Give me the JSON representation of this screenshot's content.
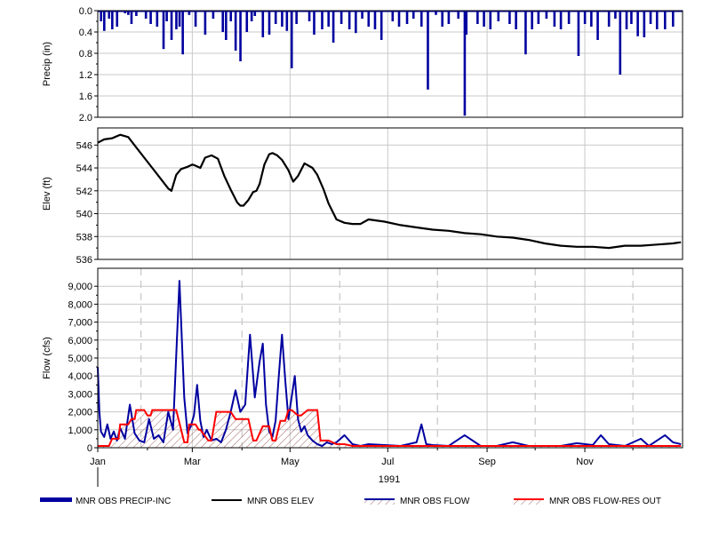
{
  "chart_data": [
    {
      "type": "bar",
      "ylabel": "Precip (in)",
      "ylim": [
        0,
        2.0
      ],
      "inverted_y": true,
      "y_ticks": [
        "0.0",
        "0.4",
        "0.8",
        "1.2",
        "1.6",
        "2.0"
      ],
      "grid": true,
      "series": [
        {
          "name": "MNR OBS PRECIP-INC",
          "color": "#0000a0",
          "day_of_year": [
            3,
            5,
            8,
            10,
            13,
            18,
            20,
            22,
            25,
            31,
            34,
            38,
            42,
            44,
            47,
            50,
            52,
            54,
            58,
            62,
            68,
            73,
            79,
            81,
            84,
            87,
            90,
            94,
            97,
            99,
            104,
            108,
            112,
            116,
            119,
            122,
            125,
            133,
            136,
            141,
            145,
            148,
            153,
            158,
            162,
            166,
            170,
            174,
            178,
            185,
            189,
            194,
            198,
            203,
            207,
            212,
            216,
            220,
            226,
            230,
            231,
            238,
            242,
            246,
            251,
            258,
            262,
            268,
            272,
            276,
            281,
            286,
            290,
            295,
            301,
            305,
            309,
            313,
            320,
            324,
            327,
            331,
            334,
            338,
            342,
            346,
            350,
            355,
            360
          ],
          "values": [
            0.2,
            0.38,
            0.15,
            0.35,
            0.3,
            0.05,
            0.08,
            0.25,
            0.1,
            0.15,
            0.25,
            0.3,
            0.72,
            0.2,
            0.55,
            0.35,
            0.3,
            0.82,
            0.08,
            0.3,
            0.45,
            0.15,
            0.4,
            0.55,
            0.2,
            0.75,
            0.95,
            0.4,
            0.2,
            0.1,
            0.5,
            0.45,
            0.25,
            0.3,
            0.38,
            1.08,
            0.25,
            0.2,
            0.45,
            0.35,
            0.3,
            0.6,
            0.25,
            0.35,
            0.42,
            0.15,
            0.3,
            0.35,
            0.55,
            0.2,
            0.3,
            0.25,
            0.15,
            0.3,
            1.48,
            0.08,
            0.3,
            0.25,
            0.15,
            1.97,
            0.45,
            0.25,
            0.3,
            0.35,
            0.2,
            0.25,
            0.35,
            0.82,
            0.35,
            0.25,
            0.15,
            0.3,
            0.35,
            0.25,
            0.85,
            0.25,
            0.3,
            0.55,
            0.3,
            0.15,
            1.2,
            0.35,
            0.25,
            0.48,
            0.5,
            0.25,
            0.35,
            0.35,
            0.3
          ]
        }
      ]
    },
    {
      "type": "line",
      "ylabel": "Elev (ft)",
      "ylim": [
        536,
        547.5
      ],
      "y_ticks": [
        "536",
        "538",
        "540",
        "542",
        "544",
        "546"
      ],
      "grid": true,
      "series": [
        {
          "name": "MNR OBS ELEV",
          "color": "#000000",
          "day_of_year": [
            1,
            5,
            10,
            15,
            20,
            25,
            30,
            35,
            40,
            45,
            47,
            50,
            53,
            57,
            60,
            62,
            65,
            68,
            72,
            76,
            80,
            84,
            88,
            90,
            92,
            95,
            98,
            100,
            102,
            105,
            108,
            110,
            113,
            116,
            120,
            123,
            126,
            130,
            135,
            138,
            142,
            145,
            150,
            155,
            160,
            165,
            170,
            180,
            190,
            200,
            210,
            220,
            230,
            240,
            250,
            260,
            270,
            280,
            290,
            300,
            310,
            320,
            330,
            340,
            350,
            360,
            365
          ],
          "values": [
            546.2,
            546.5,
            546.6,
            546.9,
            546.7,
            545.8,
            544.9,
            544.0,
            543.1,
            542.2,
            542.0,
            543.4,
            543.9,
            544.1,
            544.3,
            544.2,
            544.0,
            544.9,
            545.1,
            544.8,
            543.3,
            542.1,
            541.0,
            540.7,
            540.7,
            541.2,
            541.9,
            542.0,
            542.6,
            544.3,
            545.2,
            545.3,
            545.1,
            544.7,
            543.8,
            542.8,
            543.3,
            544.4,
            544.0,
            543.4,
            542.1,
            540.9,
            539.5,
            539.2,
            539.1,
            539.1,
            539.5,
            539.3,
            539.0,
            538.8,
            538.6,
            538.5,
            538.3,
            538.2,
            538.0,
            537.9,
            537.7,
            537.4,
            537.2,
            537.1,
            537.1,
            537.0,
            537.2,
            537.2,
            537.3,
            537.4,
            537.5
          ]
        }
      ]
    },
    {
      "type": "line",
      "ylabel": "Flow (cfs)",
      "ylim": [
        0,
        10000
      ],
      "y_ticks": [
        "0",
        "1,000",
        "2,000",
        "3,000",
        "4,000",
        "5,000",
        "6,000",
        "7,000",
        "8,000",
        "9,000"
      ],
      "xlabel": "1991",
      "x_ticks": [
        "Jan",
        "Mar",
        "May",
        "Jul",
        "Sep",
        "Nov"
      ],
      "grid": true,
      "series": [
        {
          "name": "MNR OBS FLOW",
          "color": "#0000a0",
          "day_of_year": [
            1,
            2,
            3,
            5,
            7,
            9,
            11,
            13,
            15,
            18,
            21,
            24,
            27,
            30,
            33,
            36,
            39,
            42,
            45,
            48,
            52,
            55,
            57,
            59,
            61,
            63,
            65,
            67,
            69,
            72,
            75,
            78,
            81,
            84,
            87,
            90,
            93,
            96,
            99,
            102,
            104,
            106,
            108,
            110,
            112,
            114,
            116,
            118,
            120,
            122,
            124,
            126,
            128,
            130,
            132,
            135,
            138,
            141,
            144,
            147,
            150,
            155,
            160,
            165,
            170,
            180,
            190,
            200,
            203,
            206,
            210,
            220,
            230,
            240,
            250,
            260,
            270,
            280,
            290,
            300,
            310,
            315,
            320,
            330,
            340,
            345,
            350,
            355,
            360,
            365
          ],
          "values": [
            4500,
            2000,
            900,
            600,
            1300,
            500,
            900,
            400,
            1100,
            500,
            2400,
            800,
            400,
            300,
            1600,
            500,
            700,
            300,
            2000,
            1000,
            9300,
            2800,
            800,
            1200,
            1800,
            3500,
            1500,
            600,
            1000,
            400,
            500,
            300,
            1000,
            2000,
            3200,
            2000,
            2400,
            6300,
            2800,
            4800,
            5800,
            2400,
            900,
            600,
            1500,
            4000,
            6300,
            3800,
            1600,
            2800,
            4000,
            1600,
            900,
            1200,
            700,
            400,
            200,
            100,
            300,
            200,
            300,
            700,
            200,
            100,
            200,
            150,
            100,
            300,
            1300,
            200,
            150,
            100,
            700,
            100,
            100,
            300,
            100,
            100,
            100,
            250,
            150,
            700,
            200,
            100,
            500,
            100,
            400,
            700,
            300,
            200
          ]
        },
        {
          "name": "MNR OBS FLOW-RES OUT",
          "color": "#ff0000",
          "day_of_year": [
            1,
            8,
            10,
            14,
            15,
            20,
            22,
            24,
            25,
            30,
            32,
            34,
            35,
            40,
            48,
            50,
            55,
            57,
            58,
            62,
            64,
            65,
            70,
            72,
            75,
            78,
            82,
            84,
            87,
            90,
            95,
            98,
            100,
            104,
            108,
            110,
            112,
            115,
            118,
            120,
            122,
            126,
            128,
            132,
            135,
            138,
            140,
            145,
            150,
            155,
            160,
            165,
            170,
            180,
            200,
            220,
            240,
            260,
            280,
            300,
            320,
            340,
            360,
            365
          ],
          "values": [
            100,
            100,
            500,
            500,
            1300,
            1300,
            1600,
            1600,
            2100,
            2100,
            1800,
            1800,
            2100,
            2100,
            2100,
            2100,
            300,
            300,
            1300,
            1300,
            1000,
            1000,
            400,
            400,
            2000,
            2000,
            2000,
            2000,
            1600,
            1600,
            1600,
            400,
            400,
            1200,
            1200,
            400,
            400,
            1500,
            1500,
            2100,
            2100,
            1800,
            1800,
            2100,
            2100,
            2100,
            400,
            400,
            200,
            200,
            100,
            100,
            100,
            100,
            100,
            100,
            100,
            100,
            100,
            100,
            100,
            100,
            100,
            100
          ]
        }
      ]
    }
  ],
  "legend": {
    "items": [
      {
        "label": "MNR OBS PRECIP-INC",
        "style": "thick-bar",
        "color": "#0000a0"
      },
      {
        "label": "MNR OBS ELEV",
        "style": "line",
        "color": "#000000"
      },
      {
        "label": "MNR OBS FLOW",
        "style": "hatched-line",
        "color": "#0000a0"
      },
      {
        "label": "MNR OBS FLOW-RES OUT",
        "style": "hatched-line",
        "color": "#ff0000"
      }
    ]
  },
  "colors": {
    "grid": "#c8c8c8",
    "frame": "#000000",
    "dashed_grid": "#bbbbbb"
  }
}
